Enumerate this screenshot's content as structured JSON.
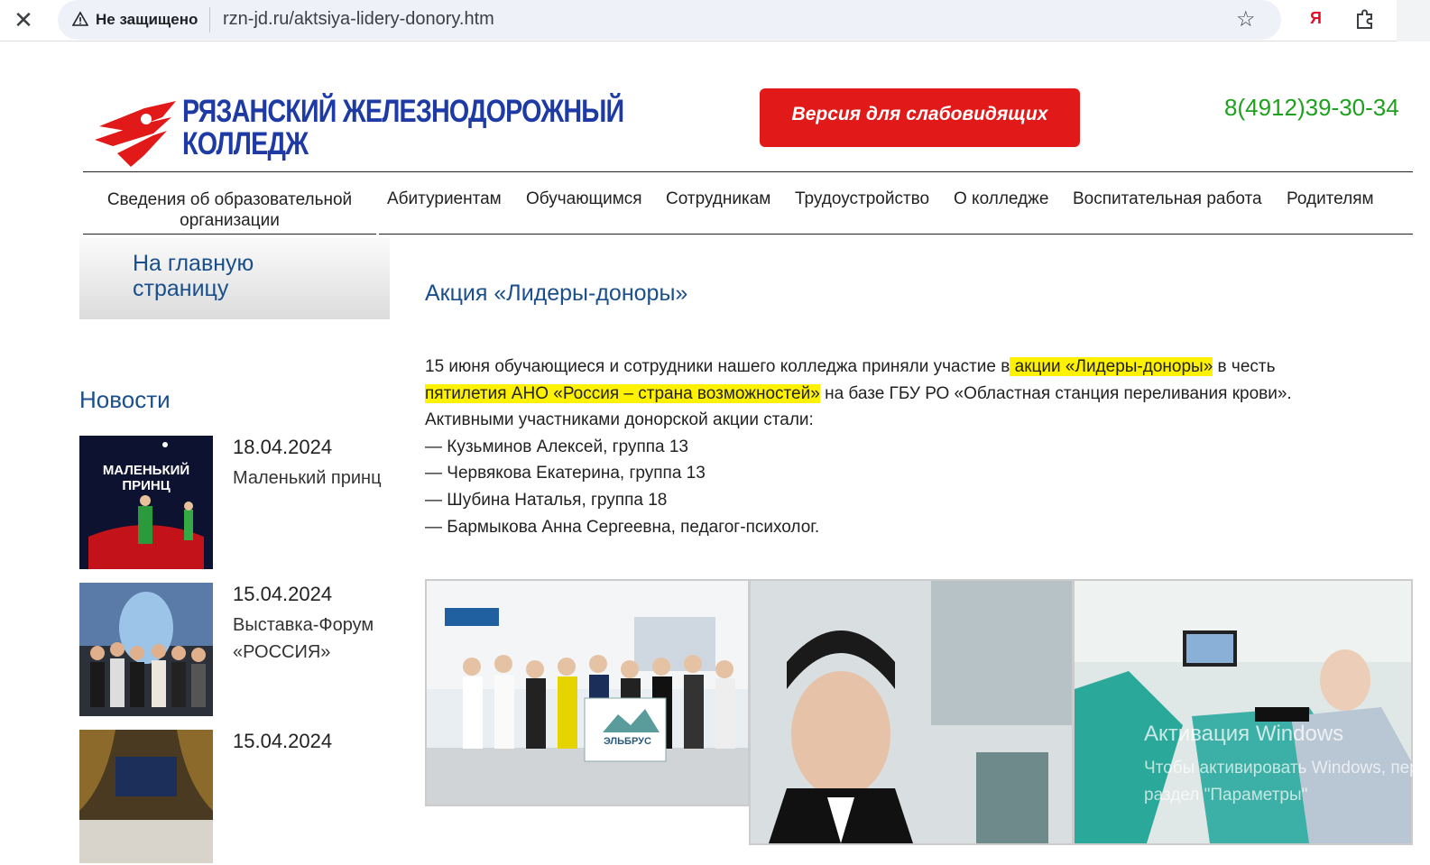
{
  "browser": {
    "security_label": "Не защищено",
    "url": "rzn-jd.ru/aktsiya-lidery-donory.htm",
    "yandex_label": "Я"
  },
  "header": {
    "logo_line1": "РЯЗАНСКИЙ ЖЕЛЕЗНОДОРОЖНЫЙ",
    "logo_line2": "КОЛЛЕДЖ",
    "vision_button": "Версия для слабовидящих",
    "phone": "8(4912)39-30-34"
  },
  "nav": {
    "items": [
      "Сведения об образовательной организации",
      "Абитуриентам",
      "Обучающимся",
      "Сотрудникам",
      "Трудоустройство",
      "О колледже",
      "Воспитательная работа",
      "Родителям"
    ]
  },
  "sidebar": {
    "home_link": "На главную страницу",
    "news_title": "Новости",
    "news": [
      {
        "date": "18.04.2024",
        "text": "Маленький принц",
        "thumb_text": "МАЛЕНЬКИЙ ПРИНЦ"
      },
      {
        "date": "15.04.2024",
        "text": "Выставка-Форум «РОССИЯ»"
      },
      {
        "date": "15.04.2024",
        "text": ""
      }
    ]
  },
  "main": {
    "title": "Акция «Лидеры-доноры»",
    "p1_a": "15 июня обучающиеся и сотрудники нашего колледжа приняли участие в",
    "p1_hl1": " акции «Лидеры-доноры»",
    "p1_b": " в честь",
    "p2_hl2": "пятилетия АНО «Россия – страна возможностей»",
    "p2_b": " на базе ГБУ РО «Областная станция переливания крови».",
    "p3": "Активными участниками донорской акции стали:",
    "participants": [
      "— Кузьминов Алексей, группа 13",
      "— Червякова Екатерина, группа 13",
      "— Шубина Наталья, группа 18",
      "— Бармыкова Анна Сергеевна, педагог-психолог."
    ],
    "flag_text": "ЭЛЬБРУС"
  },
  "os_watermark": {
    "line1": "Активация Windows",
    "line2": "Чтобы активировать Windows, перейдите в",
    "line3": "раздел \"Параметры\""
  }
}
